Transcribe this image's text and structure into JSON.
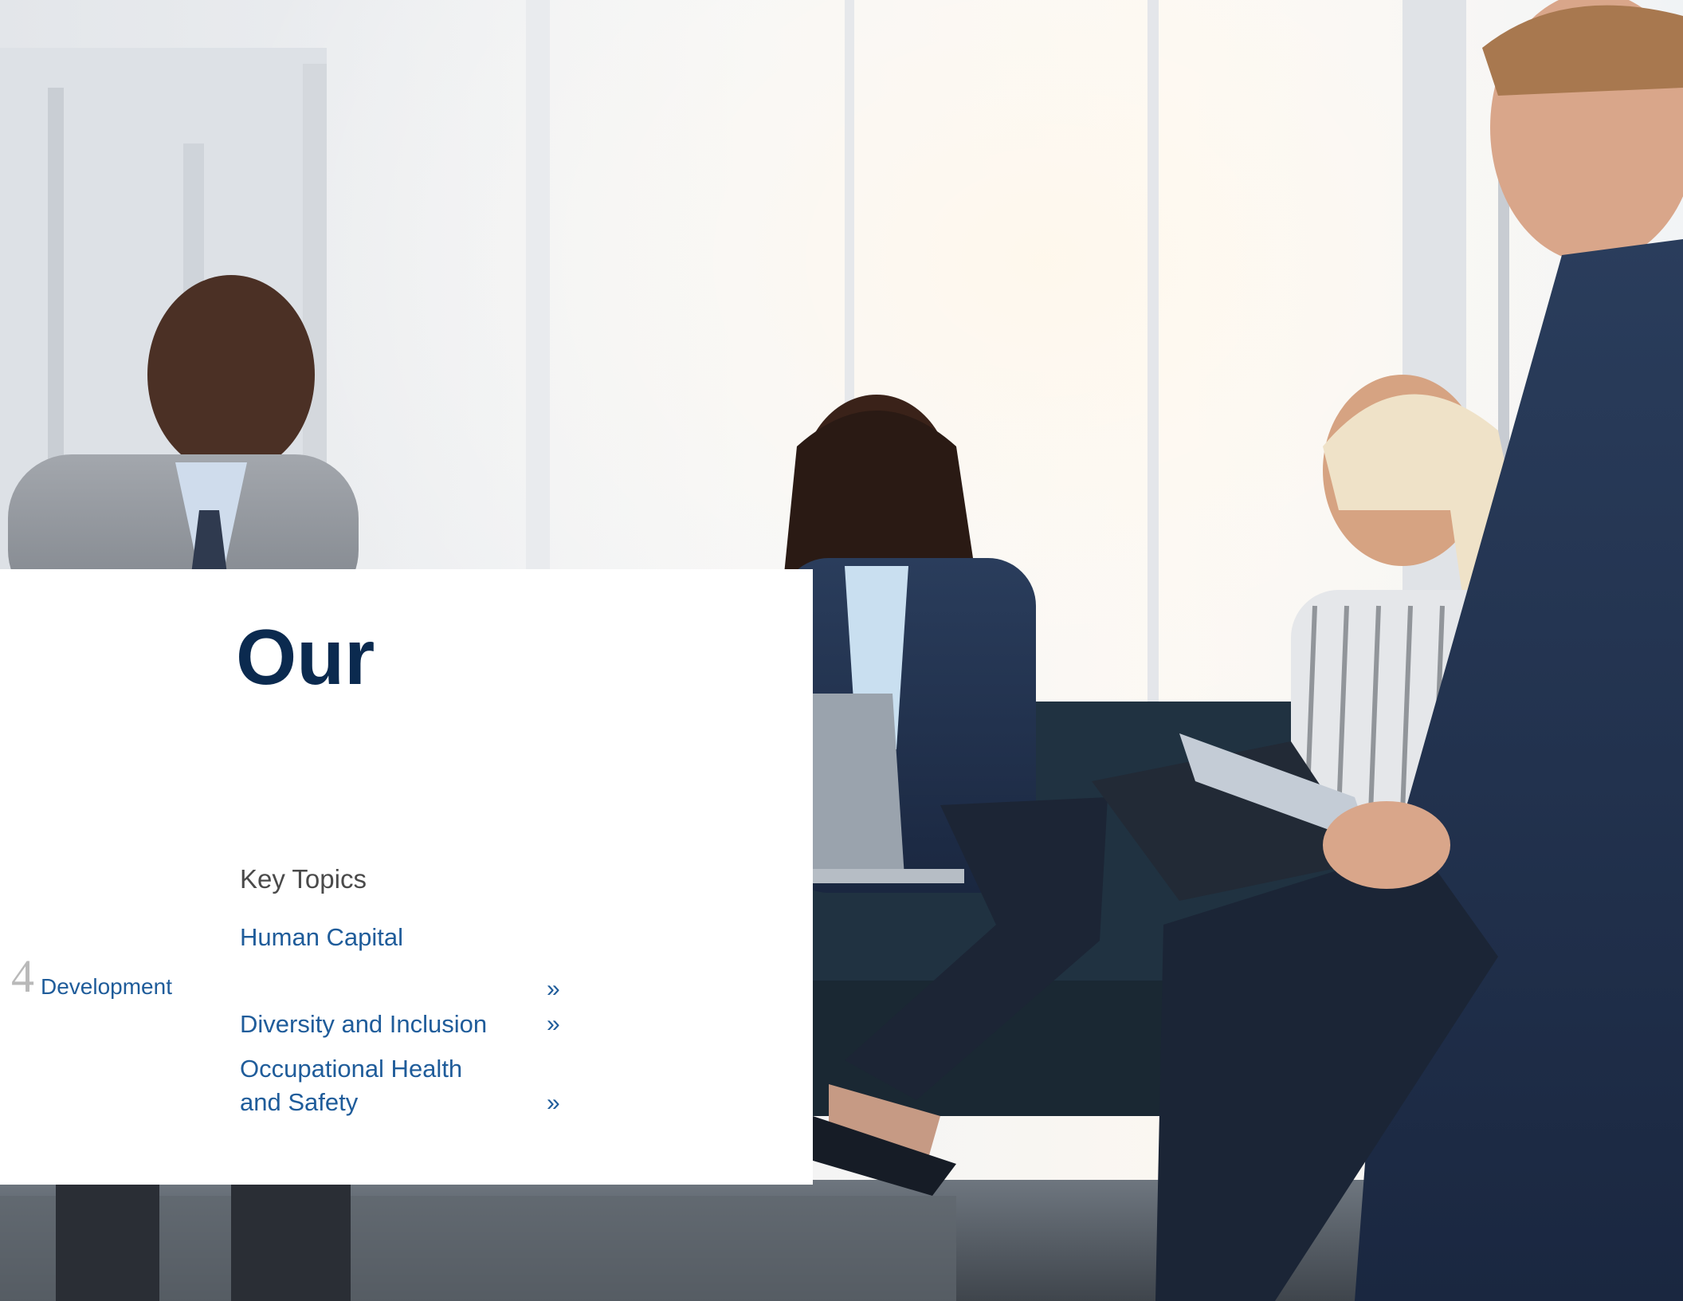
{
  "page": {
    "title": "Our",
    "key_topics_heading": "Key Topics",
    "page_number": "4",
    "side_label": "Development"
  },
  "topics": [
    {
      "line1": "Human Capital",
      "line2": "",
      "chevron": ""
    },
    {
      "line1": "",
      "line2": "",
      "chevron": "»"
    },
    {
      "line1": "Diversity and Inclusion",
      "line2": "",
      "chevron": "»"
    },
    {
      "line1": "Occupational Health",
      "line2": "and Safety",
      "chevron": "»"
    }
  ],
  "colors": {
    "title": "#0b2a4f",
    "link": "#1f5c9a",
    "heading": "#4a4a4a",
    "page_number": "#b9b9b9"
  },
  "image": {
    "description_icon": "office-team-photo"
  }
}
